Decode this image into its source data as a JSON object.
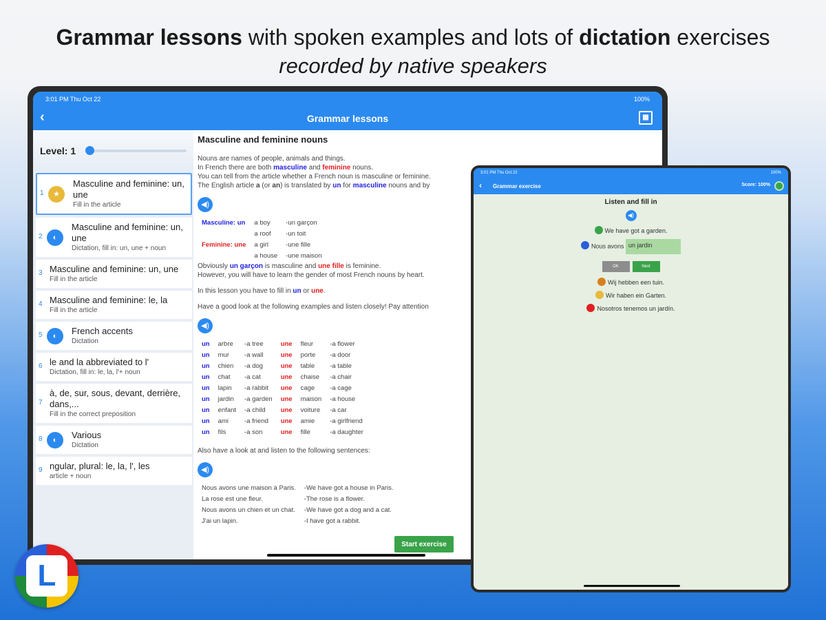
{
  "headline": {
    "bold1": "Grammar lessons",
    "text1": " with spoken examples and lots of ",
    "bold2": "dictation",
    "text2": " exercises",
    "sub": "recorded by native speakers"
  },
  "app": {
    "time": "3:01 PM   Thu Oct 22",
    "battery": "100%",
    "title": "Grammar lessons",
    "level_label": "Level: 1",
    "lessons": [
      {
        "num": "1",
        "title": "Masculine and feminine: un, une",
        "sub": "Fill in the article"
      },
      {
        "num": "2",
        "title": "Masculine and feminine: un, une",
        "sub": "Dictation, fill in: un, une + noun"
      },
      {
        "num": "3",
        "title": "Masculine and feminine: un, une",
        "sub": "Fill in the article"
      },
      {
        "num": "4",
        "title": "Masculine and feminine: le, la",
        "sub": "Fill in the article"
      },
      {
        "num": "5",
        "title": "French accents",
        "sub": "Dictation"
      },
      {
        "num": "6",
        "title": "le and la abbreviated to l'",
        "sub": "Dictation, fill in: le, la, l'+ noun"
      },
      {
        "num": "7",
        "title": "à, de, sur, sous, devant, derrière, dans,...",
        "sub": "Fill in the correct preposition"
      },
      {
        "num": "8",
        "title": "Various",
        "sub": "Dictation"
      },
      {
        "num": "9",
        "title": "ngular, plural: le, la, l', les",
        "sub": "article + noun"
      }
    ],
    "content": {
      "heading": "Masculine and feminine nouns",
      "p1": "Nouns are names of people, animals and things.",
      "p2a": "In French there are both ",
      "p2b": "masculine",
      "p2c": " and ",
      "p2d": "feminine",
      "p2e": " nouns.",
      "p3": "You can tell from the article whether a French noun is masculine or feminine.",
      "p4a": "The English article ",
      "p4b": "a",
      "p4c": " (or ",
      "p4d": "an",
      "p4e": ") is translated by ",
      "p4f": "un",
      "p4g": " for ",
      "p4h": "masculine",
      "p4i": " nouns and by",
      "grammar_rows": [
        {
          "label": "Masculine: un",
          "en": "a boy",
          "fr": "-un garçon"
        },
        {
          "label": "",
          "en": "a roof",
          "fr": "-un toit"
        },
        {
          "label": "Feminine: une",
          "en": "a girl",
          "fr": "-une fille"
        },
        {
          "label": "",
          "en": "a house",
          "fr": "-une maison"
        }
      ],
      "p5a": "Obviously ",
      "p5b": "un garçon",
      "p5c": " is masculine and ",
      "p5d": "une fille",
      "p5e": " is feminine.",
      "p6": "However, you will have to learn the gender of most French nouns by heart.",
      "p7a": "In this lesson you have to fill in ",
      "p7b": "un",
      "p7c": " or ",
      "p7d": "une",
      "p7e": ".",
      "p8": "Have a good look at the following examples and listen closely! Pay attention",
      "vocab": [
        {
          "m": "arbre",
          "me": "-a tree",
          "f": "fleur",
          "fe": "-a flower"
        },
        {
          "m": "mur",
          "me": "-a wall",
          "f": "porte",
          "fe": "-a door"
        },
        {
          "m": "chien",
          "me": "-a dog",
          "f": "table",
          "fe": "-a table"
        },
        {
          "m": "chat",
          "me": "-a cat",
          "f": "chaise",
          "fe": "-a chair"
        },
        {
          "m": "lapin",
          "me": "-a rabbit",
          "f": "cage",
          "fe": "-a cage"
        },
        {
          "m": "jardin",
          "me": "-a garden",
          "f": "maison",
          "fe": "-a house"
        },
        {
          "m": "enfant",
          "me": "-a child",
          "f": "voiture",
          "fe": "-a car"
        },
        {
          "m": "ami",
          "me": "-a friend",
          "f": "amie",
          "fe": "-a girlfriend"
        },
        {
          "m": "fils",
          "me": "-a son",
          "f": "fille",
          "fe": "-a daughter"
        }
      ],
      "un": "un",
      "une": "une",
      "p9": "Also have a look at and listen to the following sentences:",
      "sentences": [
        {
          "fr": "Nous avons une maison à Paris.",
          "en": "-We have got a house in Paris."
        },
        {
          "fr": "La rose est une fleur.",
          "en": "-The rose is a flower."
        },
        {
          "fr": "Nous avons un chien et un chat.",
          "en": "-We have got a dog and a cat."
        },
        {
          "fr": "J'ai un lapin.",
          "en": "-I have got a rabbit."
        }
      ],
      "start_button": "Start exercise"
    }
  },
  "exercise": {
    "title": "Grammar exercise",
    "score": "Score: 100%",
    "heading": "Listen and fill in",
    "english": "We have got a garden.",
    "prompt": "Nous avons",
    "input_value": "un jardin",
    "ok": "OK",
    "next": "Next",
    "dutch": "Wij hebben een tuin.",
    "german": "Wir haben ein Garten.",
    "spanish": "Nosotros tenemos un jardín."
  },
  "logo_letter": "L"
}
